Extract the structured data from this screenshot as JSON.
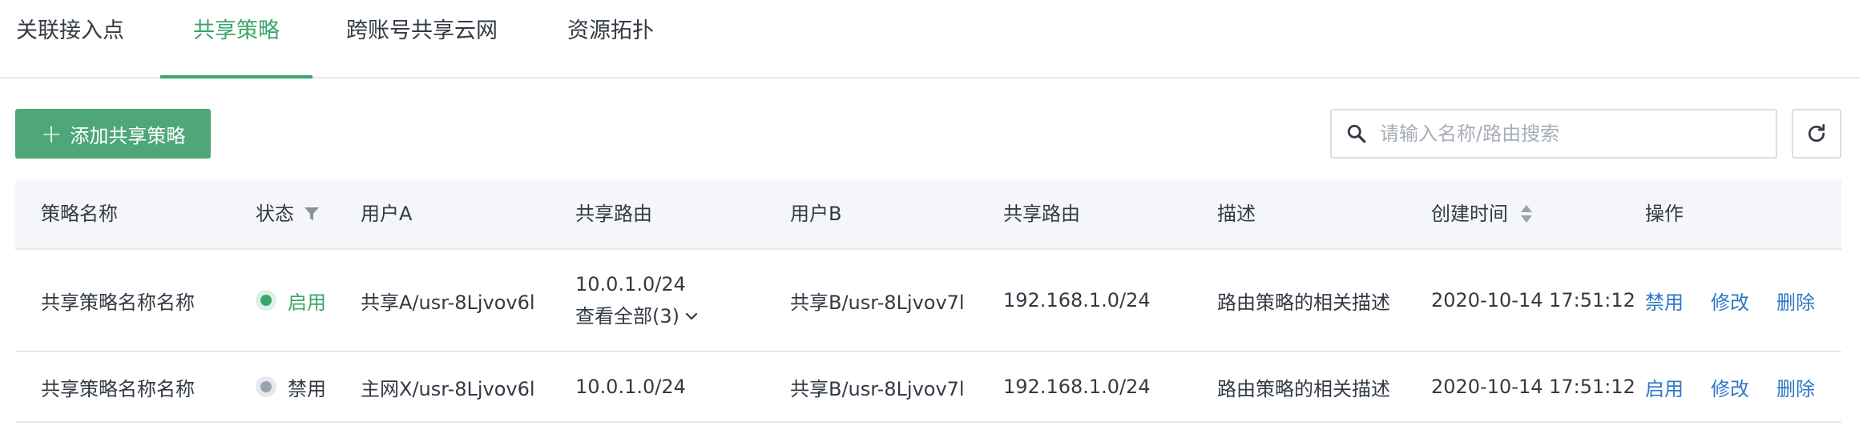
{
  "tabs": [
    {
      "label": "关联接入点"
    },
    {
      "label": "共享策略",
      "active": true
    },
    {
      "label": "跨账号共享云网"
    },
    {
      "label": "资源拓扑"
    }
  ],
  "toolbar": {
    "add_label": "添加共享策略",
    "search_placeholder": "请输入名称/路由搜索",
    "search_value": ""
  },
  "table": {
    "headers": [
      "策略名称",
      "状态",
      "用户A",
      "共享路由",
      "用户B",
      "共享路由",
      "描述",
      "创建时间",
      "操作"
    ],
    "rows": [
      {
        "name": "共享策略名称名称",
        "status": "启用",
        "status_state": "enabled",
        "user_a": "共享A/usr-8Ljvov6l",
        "route_a": "10.0.1.0/24",
        "route_a_more": "查看全部(3)",
        "user_b": "共享B/usr-8Ljvov7l",
        "route_b": "192.168.1.0/24",
        "desc": "路由策略的相关描述",
        "created": "2020-10-14 17:51:12",
        "actions": [
          "禁用",
          "修改",
          "删除"
        ]
      },
      {
        "name": "共享策略名称名称",
        "status": "禁用",
        "status_state": "disabled",
        "user_a": "主网X/usr-8Ljvov6l",
        "route_a": "10.0.1.0/24",
        "user_b": "共享B/usr-8Ljvov7l",
        "route_b": "192.168.1.0/24",
        "desc": "路由策略的相关描述",
        "created": "2020-10-14 17:51:12",
        "actions": [
          "启用",
          "修改",
          "删除"
        ]
      }
    ]
  },
  "colors": {
    "accent": "#3aa66b",
    "button": "#4ea679",
    "link": "#2f77c6"
  },
  "icons": {
    "add": "plus-icon",
    "search": "search-icon",
    "refresh": "refresh-icon",
    "filter": "filter-icon",
    "sort": "sort-icon",
    "expand": "chevron-down-icon"
  }
}
